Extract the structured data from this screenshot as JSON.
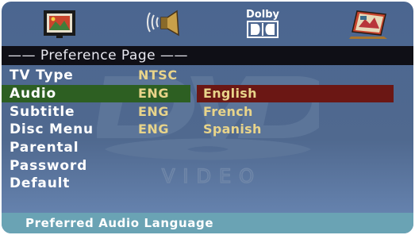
{
  "toolbar": {
    "items": [
      {
        "icon": "picture-setup-icon"
      },
      {
        "icon": "speaker-setup-icon"
      },
      {
        "icon": "dolby-digital-setup-icon",
        "label": "Dolby"
      },
      {
        "icon": "preference-setup-icon"
      }
    ]
  },
  "title": "—— Preference Page ——",
  "watermark_text": "VIDEO",
  "menu": {
    "items": [
      "TV Type",
      "Audio",
      "Subtitle",
      "Disc Menu",
      "Parental",
      "Password",
      "Default"
    ],
    "values": [
      "NTSC",
      "ENG",
      "ENG",
      "ENG"
    ],
    "selected": "Audio"
  },
  "options": {
    "items": [
      "English",
      "French",
      "Spanish"
    ],
    "selected": "English"
  },
  "status": "Preferred Audio Language",
  "colors": {
    "panel_bg": "#50698f",
    "title_bar": "#0f0f16",
    "selected_row": "#2d5f22",
    "selected_option": "#6b1714",
    "value_text": "#e8d48a",
    "status_bar": "#6aa3b4"
  }
}
